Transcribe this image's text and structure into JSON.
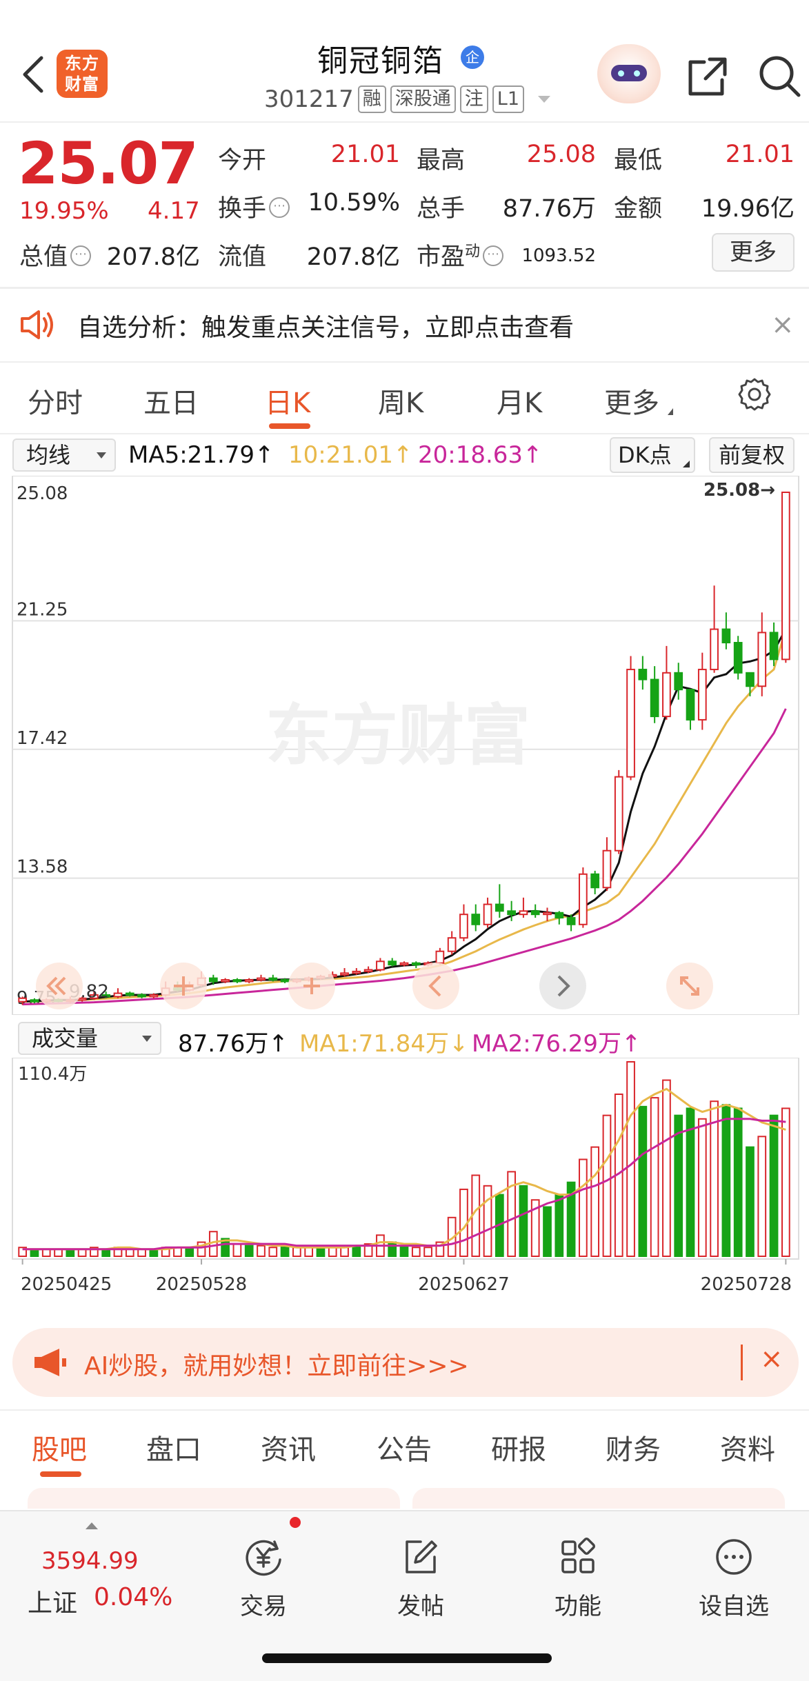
{
  "header": {
    "logo_text_line1": "东方",
    "logo_text_line2": "财富",
    "stock_name": "铜冠铜箔",
    "enterprise_badge": "企",
    "stock_code": "301217",
    "tags": [
      "融",
      "深股通",
      "注",
      "L1"
    ]
  },
  "quote": {
    "price": "25.07",
    "change_pct": "19.95%",
    "change": "4.17",
    "open_label": "今开",
    "open": "21.01",
    "high_label": "最高",
    "high": "25.08",
    "low_label": "最低",
    "low": "21.01",
    "turnover_label": "换手",
    "turnover": "10.59%",
    "volume_label": "总手",
    "volume": "87.76万",
    "amount_label": "金额",
    "amount": "19.96亿",
    "mktcap_label": "总值",
    "mktcap": "207.8亿",
    "float_label": "流值",
    "float": "207.8亿",
    "pe_label": "市盈",
    "pe_sup": "动",
    "pe": "1093.52",
    "more_label": "更多"
  },
  "alert": {
    "text": "自选分析：触发重点关注信号，立即点击查看",
    "close": "×"
  },
  "tabs": [
    {
      "label": "分时"
    },
    {
      "label": "五日"
    },
    {
      "label": "日K"
    },
    {
      "label": "周K"
    },
    {
      "label": "月K"
    },
    {
      "label": "更多"
    }
  ],
  "active_tab": "日K",
  "ma_row": {
    "select": "均线",
    "ma5": "MA5:21.79↑",
    "ma10": "10:21.01↑",
    "ma20": "20:18.63↑",
    "dk": "DK点",
    "adjust": "前复权"
  },
  "vol_row": {
    "select": "成交量",
    "vol": "87.76万↑",
    "ma1": "MA1:71.84万↓",
    "ma2": "MA2:76.29万↑"
  },
  "colors": {
    "up": "#d9262b",
    "down": "#16a316",
    "ma5": "#111111",
    "ma10": "#e8b84a",
    "ma20": "#c8269a",
    "accent": "#e8562a"
  },
  "chart_data": [
    {
      "type": "candlestick",
      "y_ticks": [
        "25.08",
        "21.25",
        "17.42",
        "13.58",
        "9.75"
      ],
      "ylim": [
        9.75,
        25.08
      ],
      "max_label": "25.08→",
      "min_label": "9.82",
      "series": [
        {
          "name": "MA5",
          "value": "21.79"
        },
        {
          "name": "10",
          "value": "21.01"
        },
        {
          "name": "20",
          "value": "18.63"
        }
      ],
      "candles": [
        [
          9.9,
          10.0,
          9.8,
          10.05
        ],
        [
          9.95,
          9.9,
          9.85,
          10.0
        ],
        [
          9.9,
          9.95,
          9.85,
          10.0
        ],
        [
          9.95,
          9.92,
          9.88,
          10.0
        ],
        [
          9.92,
          9.95,
          9.85,
          10.05
        ],
        [
          9.95,
          10.0,
          9.9,
          10.05
        ],
        [
          10.0,
          10.1,
          9.95,
          10.2
        ],
        [
          10.1,
          10.05,
          10.0,
          10.2
        ],
        [
          10.05,
          10.15,
          10.0,
          10.3
        ],
        [
          10.15,
          10.1,
          10.05,
          10.2
        ],
        [
          10.1,
          10.05,
          10.0,
          10.15
        ],
        [
          10.05,
          10.1,
          10.0,
          10.15
        ],
        [
          10.1,
          10.3,
          10.05,
          10.5
        ],
        [
          10.3,
          10.25,
          10.2,
          10.5
        ],
        [
          10.25,
          10.4,
          10.2,
          10.5
        ],
        [
          10.4,
          10.6,
          10.35,
          10.8
        ],
        [
          10.6,
          10.5,
          10.4,
          10.7
        ],
        [
          10.5,
          10.55,
          10.45,
          10.6
        ],
        [
          10.55,
          10.5,
          10.45,
          10.6
        ],
        [
          10.5,
          10.55,
          10.45,
          10.6
        ],
        [
          10.55,
          10.6,
          10.5,
          10.7
        ],
        [
          10.6,
          10.55,
          10.5,
          10.7
        ],
        [
          10.55,
          10.5,
          10.45,
          10.6
        ],
        [
          10.5,
          10.55,
          10.45,
          10.6
        ],
        [
          10.55,
          10.6,
          10.5,
          10.65
        ],
        [
          10.6,
          10.65,
          10.55,
          10.7
        ],
        [
          10.65,
          10.7,
          10.6,
          10.8
        ],
        [
          10.7,
          10.75,
          10.65,
          10.9
        ],
        [
          10.75,
          10.8,
          10.7,
          10.9
        ],
        [
          10.8,
          10.85,
          10.75,
          10.95
        ],
        [
          10.85,
          11.1,
          10.8,
          11.2
        ],
        [
          11.1,
          11.0,
          10.95,
          11.2
        ],
        [
          11.0,
          11.05,
          10.95,
          11.1
        ],
        [
          11.05,
          11.0,
          10.9,
          11.1
        ],
        [
          11.0,
          11.05,
          10.95,
          11.1
        ],
        [
          11.05,
          11.4,
          11.0,
          11.5
        ],
        [
          11.4,
          11.8,
          11.3,
          12.0
        ],
        [
          11.8,
          12.5,
          11.7,
          12.8
        ],
        [
          12.5,
          12.2,
          12.0,
          12.8
        ],
        [
          12.2,
          12.8,
          12.1,
          13.0
        ],
        [
          12.8,
          12.6,
          12.4,
          13.4
        ],
        [
          12.6,
          12.5,
          12.3,
          12.9
        ],
        [
          12.5,
          12.6,
          12.4,
          13.0
        ],
        [
          12.6,
          12.5,
          12.4,
          12.8
        ],
        [
          12.5,
          12.55,
          12.3,
          12.7
        ],
        [
          12.55,
          12.4,
          12.2,
          12.6
        ],
        [
          12.4,
          12.2,
          12.0,
          12.5
        ],
        [
          12.2,
          13.7,
          12.1,
          13.9
        ],
        [
          13.7,
          13.3,
          13.1,
          13.8
        ],
        [
          13.3,
          14.4,
          13.2,
          14.8
        ],
        [
          14.4,
          16.6,
          14.3,
          16.8
        ],
        [
          16.6,
          19.8,
          16.5,
          20.2
        ],
        [
          19.8,
          19.5,
          19.2,
          20.2
        ],
        [
          19.5,
          18.4,
          18.2,
          19.9
        ],
        [
          18.4,
          19.7,
          18.3,
          20.5
        ],
        [
          19.7,
          19.2,
          18.9,
          20.0
        ],
        [
          19.2,
          18.3,
          18.0,
          19.0
        ],
        [
          18.3,
          19.8,
          18.0,
          20.3
        ],
        [
          19.8,
          21.0,
          19.7,
          22.3
        ],
        [
          21.0,
          20.6,
          20.4,
          21.5
        ],
        [
          20.6,
          19.7,
          19.5,
          20.8
        ],
        [
          19.7,
          19.3,
          19.0,
          19.6
        ],
        [
          19.3,
          20.9,
          19.0,
          21.5
        ],
        [
          20.9,
          20.1,
          19.9,
          21.2
        ],
        [
          20.1,
          25.08,
          20.0,
          25.08
        ]
      ],
      "ma5": [
        9.9,
        9.92,
        9.93,
        9.95,
        9.95,
        9.96,
        10.0,
        10.04,
        10.08,
        10.1,
        10.1,
        10.1,
        10.15,
        10.2,
        10.25,
        10.35,
        10.45,
        10.5,
        10.52,
        10.54,
        10.55,
        10.55,
        10.56,
        10.56,
        10.57,
        10.58,
        10.62,
        10.67,
        10.72,
        10.78,
        10.86,
        10.94,
        10.98,
        11.0,
        11.04,
        11.12,
        11.28,
        11.54,
        11.76,
        12.06,
        12.3,
        12.46,
        12.58,
        12.6,
        12.56,
        12.52,
        12.43,
        12.72,
        12.94,
        13.26,
        14.04,
        15.56,
        16.7,
        17.5,
        18.48,
        19.3,
        19.22,
        19.1,
        19.56,
        19.66,
        19.98,
        20.04,
        20.14,
        20.36,
        21.0
      ],
      "ma10": [
        9.9,
        9.91,
        9.92,
        9.93,
        9.94,
        9.95,
        9.97,
        9.99,
        10.01,
        10.03,
        10.05,
        10.07,
        10.09,
        10.12,
        10.15,
        10.2,
        10.27,
        10.32,
        10.36,
        10.4,
        10.44,
        10.48,
        10.51,
        10.53,
        10.55,
        10.57,
        10.58,
        10.6,
        10.62,
        10.65,
        10.7,
        10.75,
        10.8,
        10.85,
        10.9,
        10.98,
        11.1,
        11.25,
        11.4,
        11.58,
        11.75,
        11.9,
        12.05,
        12.18,
        12.3,
        12.4,
        12.46,
        12.58,
        12.7,
        12.84,
        13.1,
        13.6,
        14.1,
        14.6,
        15.2,
        15.8,
        16.4,
        17.0,
        17.6,
        18.2,
        18.7,
        19.1,
        19.5,
        19.8,
        21.01
      ],
      "ma20": [
        9.82,
        9.83,
        9.84,
        9.85,
        9.86,
        9.87,
        9.88,
        9.9,
        9.92,
        9.94,
        9.96,
        9.98,
        10.0,
        10.02,
        10.04,
        10.07,
        10.1,
        10.13,
        10.16,
        10.19,
        10.22,
        10.25,
        10.28,
        10.31,
        10.34,
        10.37,
        10.4,
        10.43,
        10.46,
        10.49,
        10.52,
        10.56,
        10.6,
        10.65,
        10.7,
        10.76,
        10.82,
        10.9,
        10.98,
        11.08,
        11.18,
        11.28,
        11.38,
        11.48,
        11.58,
        11.68,
        11.78,
        11.9,
        12.02,
        12.16,
        12.34,
        12.6,
        12.9,
        13.25,
        13.6,
        14.0,
        14.45,
        14.9,
        15.4,
        15.9,
        16.4,
        16.9,
        17.4,
        17.9,
        18.63
      ]
    },
    {
      "type": "bar",
      "ymax_label": "110.4万",
      "ylim": [
        0,
        110.4
      ],
      "x_ticks": [
        "20250425",
        "20250528",
        "20250627",
        "20250728"
      ],
      "series": [
        {
          "name": "MA1",
          "value": "71.84万"
        },
        {
          "name": "MA2",
          "value": "76.29万"
        }
      ],
      "volumes": [
        5,
        4,
        4,
        4,
        4,
        4,
        5,
        4,
        5,
        4,
        4,
        4,
        5,
        5,
        5,
        8,
        14,
        10,
        7,
        6,
        6,
        5,
        6,
        5,
        6,
        5,
        5,
        5,
        6,
        7,
        12,
        8,
        6,
        5,
        5,
        8,
        22,
        38,
        46,
        40,
        35,
        48,
        40,
        32,
        28,
        35,
        42,
        55,
        62,
        80,
        92,
        110.4,
        85,
        90,
        100,
        80,
        84,
        78,
        88,
        86,
        84,
        62,
        68,
        80,
        84
      ],
      "vol_up": [
        1,
        0,
        1,
        1,
        0,
        1,
        1,
        0,
        1,
        1,
        1,
        0,
        1,
        1,
        0,
        1,
        1,
        0,
        1,
        0,
        1,
        1,
        0,
        1,
        1,
        0,
        1,
        1,
        0,
        1,
        1,
        0,
        0,
        1,
        1,
        1,
        1,
        1,
        1,
        1,
        0,
        1,
        0,
        1,
        0,
        0,
        0,
        1,
        1,
        1,
        1,
        1,
        0,
        1,
        1,
        0,
        0,
        1,
        1,
        0,
        0,
        0,
        1,
        0,
        1
      ],
      "ma1": [
        4,
        4,
        4,
        4,
        4,
        4,
        4,
        4,
        5,
        5,
        4,
        4,
        4,
        5,
        5,
        6,
        8,
        9,
        9,
        8,
        7,
        6,
        6,
        5,
        5,
        5,
        5,
        5,
        6,
        6,
        8,
        8,
        7,
        7,
        6,
        6,
        10,
        16,
        26,
        32,
        36,
        40,
        42,
        40,
        37,
        35,
        35,
        40,
        46,
        55,
        66,
        80,
        88,
        92,
        95,
        90,
        85,
        82,
        84,
        86,
        84,
        80,
        76,
        74,
        71.84
      ],
      "ma2": [
        4,
        4,
        4,
        4,
        4,
        4,
        4,
        4,
        4,
        4,
        4,
        4,
        5,
        5,
        5,
        5,
        6,
        7,
        7,
        7,
        7,
        7,
        7,
        6,
        6,
        6,
        6,
        6,
        6,
        6,
        6,
        6,
        6,
        6,
        6,
        6,
        7,
        9,
        12,
        15,
        18,
        21,
        24,
        27,
        30,
        32,
        35,
        38,
        40,
        43,
        47,
        52,
        58,
        62,
        66,
        70,
        72,
        74,
        76,
        78,
        78,
        78,
        77,
        77,
        76.29
      ]
    }
  ],
  "ai_banner": {
    "text": "AI炒股，就用妙想！立即前往>>>",
    "close": "×"
  },
  "bottom_tabs": [
    {
      "label": "股吧"
    },
    {
      "label": "盘口"
    },
    {
      "label": "资讯"
    },
    {
      "label": "公告"
    },
    {
      "label": "研报"
    },
    {
      "label": "财务"
    },
    {
      "label": "资料"
    }
  ],
  "bottom_bar": {
    "index_value": "3594.99",
    "index_name": "上证",
    "index_pct": "0.04%",
    "nav": [
      {
        "label": "交易"
      },
      {
        "label": "发帖"
      },
      {
        "label": "功能"
      },
      {
        "label": "设自选"
      }
    ]
  }
}
